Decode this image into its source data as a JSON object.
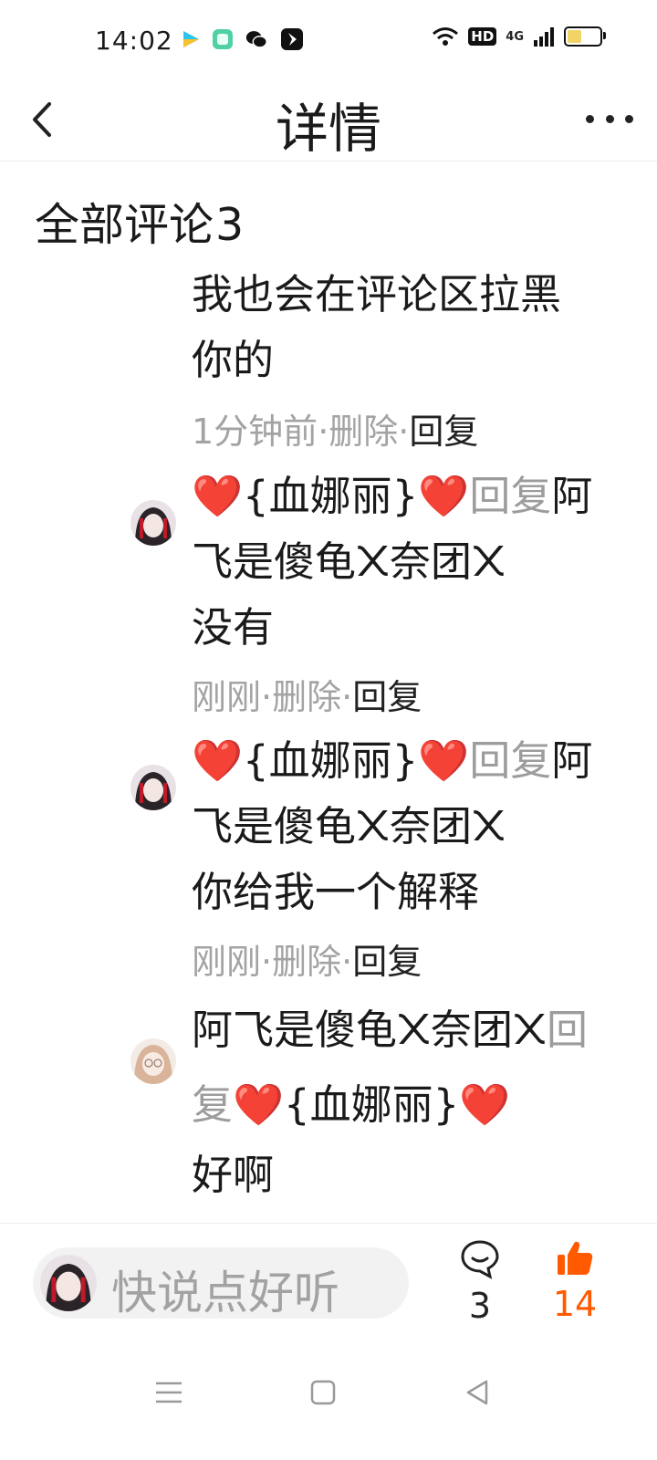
{
  "status": {
    "time": "14:02",
    "hd": "HD",
    "network": "4G",
    "battery_level": 0.45
  },
  "header": {
    "title": "详情"
  },
  "comments_section": {
    "title": "全部评论",
    "count": "3",
    "items": [
      {
        "lines": [
          "我也会在评论区拉黑",
          "你的"
        ],
        "time": "1分钟前",
        "delete": "删除",
        "reply": "回复"
      },
      {
        "user": "❤️{血娜丽}❤️",
        "reply_word": "回复",
        "target_line1": "阿",
        "target_line2": "飞是傻龟᙭奈团᙭",
        "text": "没有",
        "time": "刚刚",
        "delete": "删除",
        "reply": "回复"
      },
      {
        "user": "❤️{血娜丽}❤️",
        "reply_word": "回复",
        "target_line1": "阿",
        "target_line2": "飞是傻龟᙭奈团᙭",
        "text": "你给我一个解释",
        "time": "刚刚",
        "delete": "删除",
        "reply": "回复"
      },
      {
        "user": "阿飞是傻龟᙭奈团᙭",
        "reply_word1": "回",
        "reply_word2": "复",
        "target": "❤️{血娜丽}❤️",
        "text": "好啊"
      }
    ]
  },
  "bottom_bar": {
    "placeholder": "快说点好听",
    "comment_count": "3",
    "like_count": "14"
  },
  "colors": {
    "accent": "#ff5a00",
    "meta_gray": "#a3a3a3"
  }
}
